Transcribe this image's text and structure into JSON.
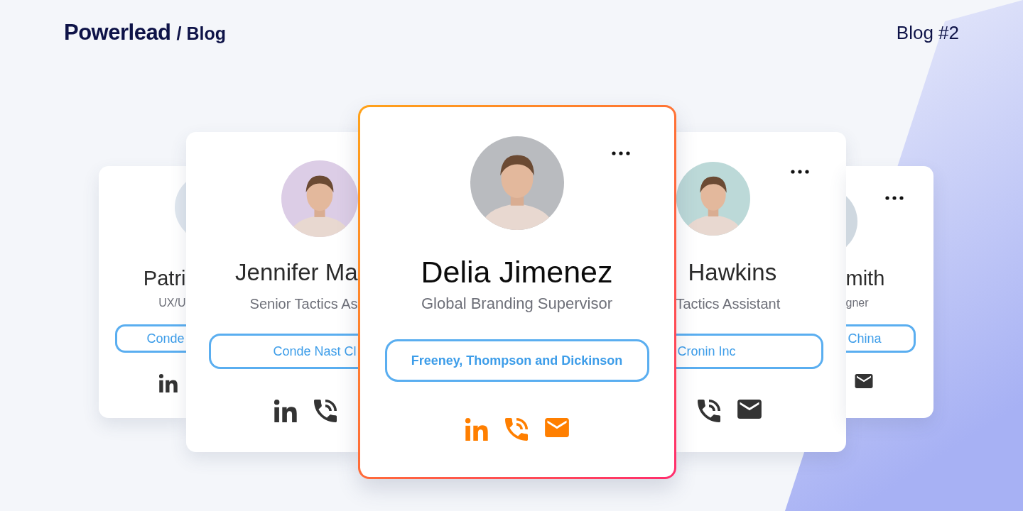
{
  "header": {
    "brand": "Powerlead",
    "section": "/ Blog",
    "label": "Blog #2"
  },
  "cards": [
    {
      "kind": "left-edge",
      "name": "Patri",
      "title": "UX/U",
      "company": "Conde",
      "icons": [
        {
          "kind": "linkedin"
        }
      ],
      "highlighted": false
    },
    {
      "kind": "left",
      "name": "Jennifer Ma",
      "title": "Senior Tactics As",
      "company": "Conde Nast Cl",
      "icons": [
        {
          "kind": "linkedin"
        },
        {
          "kind": "phone"
        }
      ],
      "highlighted": false
    },
    {
      "kind": "front",
      "name": "Delia Jimenez",
      "title": "Global Branding Supervisor",
      "company": "Freeney, Thompson and Dickinson",
      "icons": [
        {
          "kind": "linkedin"
        },
        {
          "kind": "phone"
        },
        {
          "kind": "mail"
        }
      ],
      "menu": true,
      "highlighted": true
    },
    {
      "kind": "right",
      "name": "Hawkins",
      "title": "Tactics Assistant",
      "company": "Cronin Inc",
      "icons": [
        {
          "kind": "phone"
        },
        {
          "kind": "mail"
        }
      ],
      "menu": true,
      "highlighted": false
    },
    {
      "kind": "right-edge",
      "name": "mith",
      "title": "gner",
      "company": "China",
      "icons": [
        {
          "kind": "mail"
        }
      ],
      "menu": true,
      "highlighted": false
    }
  ]
}
